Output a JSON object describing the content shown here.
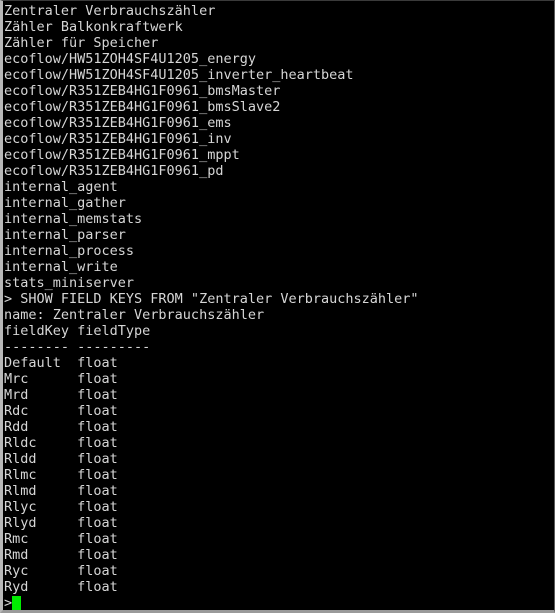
{
  "window": {
    "type": "terminal",
    "background_color": "#000000",
    "foreground_color": "#d6d6d6",
    "cursor_color": "#00ee00",
    "border_color": "#b8b8b8"
  },
  "terminal": {
    "measurement_list": [
      "Zentraler Verbrauchszähler",
      "Zähler Balkonkraftwerk",
      "Zähler für Speicher",
      "ecoflow/HW51ZOH4SF4U1205_energy",
      "ecoflow/HW51ZOH4SF4U1205_inverter_heartbeat",
      "ecoflow/R351ZEB4HG1F0961_bmsMaster",
      "ecoflow/R351ZEB4HG1F0961_bmsSlave2",
      "ecoflow/R351ZEB4HG1F0961_ems",
      "ecoflow/R351ZEB4HG1F0961_inv",
      "ecoflow/R351ZEB4HG1F0961_mppt",
      "ecoflow/R351ZEB4HG1F0961_pd",
      "internal_agent",
      "internal_gather",
      "internal_memstats",
      "internal_parser",
      "internal_process",
      "internal_write",
      "stats_miniserver"
    ],
    "command_line": "> SHOW FIELD KEYS FROM \"Zentraler Verbrauchszähler\"",
    "result_name_line": "name: Zentraler Verbrauchszähler",
    "column_headers": "fieldKey fieldType",
    "column_separator": "-------- ---------",
    "field_keys": [
      {
        "key": "Default",
        "type": "float"
      },
      {
        "key": "Mrc",
        "type": "float"
      },
      {
        "key": "Mrd",
        "type": "float"
      },
      {
        "key": "Rdc",
        "type": "float"
      },
      {
        "key": "Rdd",
        "type": "float"
      },
      {
        "key": "Rldc",
        "type": "float"
      },
      {
        "key": "Rldd",
        "type": "float"
      },
      {
        "key": "Rlmc",
        "type": "float"
      },
      {
        "key": "Rlmd",
        "type": "float"
      },
      {
        "key": "Rlyc",
        "type": "float"
      },
      {
        "key": "Rlyd",
        "type": "float"
      },
      {
        "key": "Rmc",
        "type": "float"
      },
      {
        "key": "Rmd",
        "type": "float"
      },
      {
        "key": "Ryc",
        "type": "float"
      },
      {
        "key": "Ryd",
        "type": "float"
      }
    ],
    "final_prompt": ">"
  }
}
